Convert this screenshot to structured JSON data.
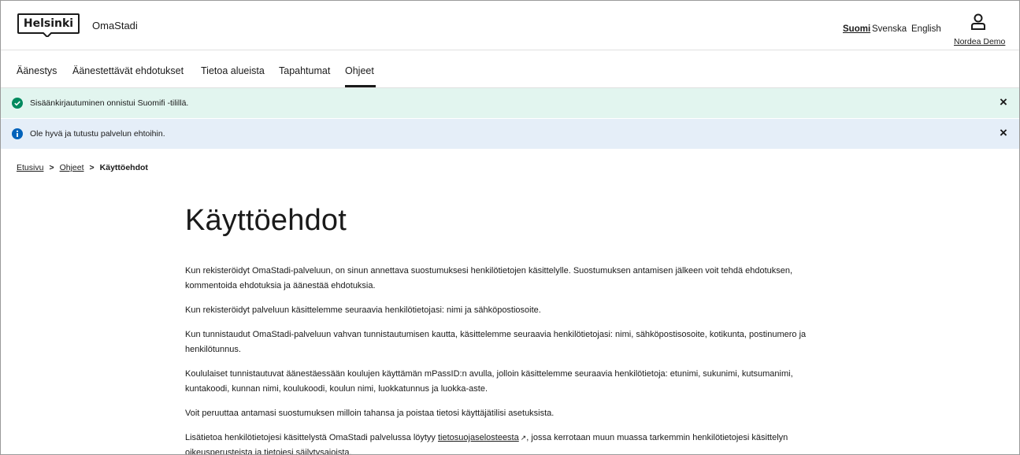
{
  "header": {
    "logo_text": "Helsinki",
    "service_name": "OmaStadi",
    "languages": [
      "Suomi",
      "Svenska",
      "English"
    ],
    "user_name": "Nordea Demo"
  },
  "nav": {
    "items": [
      "Äänestys",
      "Äänestettävät ehdotukset",
      "Tietoa alueista",
      "Tapahtumat",
      "Ohjeet"
    ]
  },
  "notifications": [
    {
      "text": "Sisäänkirjautuminen onnistui Suomifi -tilillä.",
      "close": "×"
    },
    {
      "text": "Ole hyvä ja tutustu palvelun ehtoihin.",
      "close": "×"
    }
  ],
  "breadcrumb": {
    "items": [
      "Etusivu",
      "Ohjeet",
      "Käyttöehdot"
    ],
    "separator": ">"
  },
  "page": {
    "title": "Käyttöehdot",
    "paragraphs": [
      "Kun rekisteröidyt OmaStadi-palveluun, on sinun annettava suostumuksesi henkilötietojen käsittelylle. Suostumuksen antamisen jälkeen voit tehdä ehdotuksen, kommentoida ehdotuksia ja äänestää ehdotuksia.",
      "Kun rekisteröidyt palveluun käsittelemme seuraavia henkilötietojasi: nimi ja sähköpostiosoite.",
      "Kun tunnistaudut OmaStadi-palveluun vahvan tunnistautumisen kautta, käsittelemme seuraavia henkilötietojasi: nimi, sähköpostisosoite, kotikunta, postinumero ja henkilötunnus.",
      "Koululaiset tunnistautuvat äänestäessään koulujen käyttämän mPassID:n avulla, jolloin käsittelemme seuraavia henkilötietoja: etunimi, sukunimi, kutsumanimi, kuntakoodi, kunnan nimi, koulukoodi, koulun nimi, luokkatunnus ja luokka-aste.",
      "Voit peruuttaa antamasi suostumuksen milloin tahansa ja poistaa tietosi käyttäjätilisi asetuksista."
    ],
    "last_paragraph": {
      "before": "Lisätietoa henkilötietojesi käsittelystä OmaStadi palvelussa löytyy ",
      "link": "tietosuojaselosteesta",
      "after": ", jossa kerrotaan muun muassa tarkemmin henkilötietojesi käsittelyn oikeusperusteista ja tietojesi säilytysajoista."
    }
  },
  "colors": {
    "success_bg": "#e2f5ef",
    "success_icon": "#008a5e",
    "info_bg": "#e5eef8",
    "info_icon": "#0062ba"
  }
}
